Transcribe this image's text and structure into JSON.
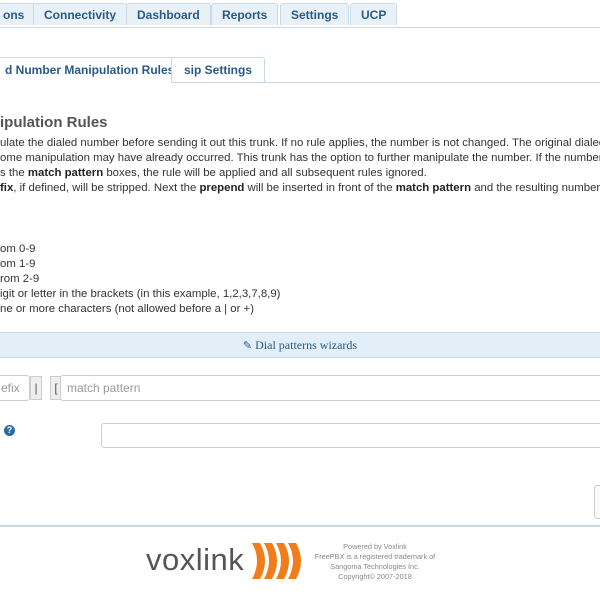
{
  "nav": {
    "items": [
      "ons",
      "Connectivity",
      "Dashboard",
      "Reports",
      "Settings",
      "UCP"
    ]
  },
  "tabs": {
    "active": "d Number Manipulation Rules",
    "other": "sip Settings"
  },
  "section": {
    "title": "ipulation Rules",
    "lines": [
      {
        "pre": "ulate the dialed number before sending it out this trunk. If no rule applies, the number is not changed. The original dialed n"
      },
      {
        "pre": "ome manipulation may have already occurred. This trunk has the option to further manipulate the number. If the number r"
      },
      {
        "pre": "s the ",
        "b1": "match pattern",
        "post": " boxes, the rule will be applied and all subsequent rules ignored."
      },
      {
        "b0": "fix",
        "pre": ", if defined, will be stripped. Next the ",
        "b1": "prepend",
        "mid": " will be inserted in front of the ",
        "b2": "match pattern",
        "post": " and the resulting number w"
      }
    ],
    "rules": [
      "om 0-9",
      "om 1-9",
      "rom 2-9",
      "igit or letter in the brackets (in this example, 1,2,3,7,8,9)",
      "ne or more characters (not allowed before a | or +)"
    ]
  },
  "wizard": {
    "label": "Dial patterns wizards",
    "icon": "pencil-icon"
  },
  "pattern_row": {
    "prefix_placeholder": "efix",
    "bar": "|",
    "bracket": "[",
    "match_placeholder": "match pattern"
  },
  "colors": {
    "accent": "#2a5a85",
    "wizard_bg": "#e2eef8",
    "logo_orange": "#f07d1a"
  },
  "footer": {
    "logo_text": "voxlink",
    "powered": "Powered by Voxlink",
    "tm1": "FreePBX is a registered trademark of",
    "tm2": "Sangoma Technologies Inc.",
    "copyright": "Copyright© 2007-2018"
  }
}
